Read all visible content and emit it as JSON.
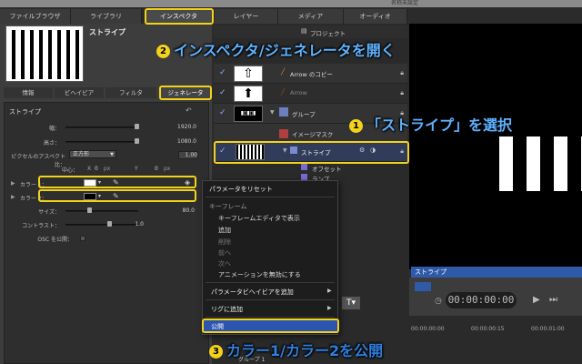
{
  "window": {
    "title": "名称未設定"
  },
  "top_tabs": [
    "ファイルブラウザ",
    "ライブラリ",
    "インスペクタ",
    "レイヤー",
    "メディア",
    "オーディオ"
  ],
  "inspector": {
    "preview_title": "ストライプ",
    "subtabs": [
      "情報",
      "ビヘイビア",
      "フィルタ",
      "ジェネレータ"
    ],
    "section_title": "ストライプ",
    "params": {
      "width": {
        "label": "幅：",
        "value": "1920.0"
      },
      "height": {
        "label": "高さ：",
        "value": "1080.0"
      },
      "pixel_aspect": {
        "label": "ピクセルのアスペクト比：",
        "option": "正方形",
        "value": "1.00"
      },
      "center": {
        "label": "中心：",
        "x_label": "X",
        "x_value": "0",
        "x_unit": "px",
        "y_label": "Y",
        "y_value": "0",
        "y_unit": "px"
      },
      "color1": {
        "label": "カラー 1：",
        "swatch": "#ffffff"
      },
      "color2": {
        "label": "カラー 2：",
        "swatch": "#000000"
      },
      "size": {
        "label": "サイズ：",
        "value": "80.0"
      },
      "contrast": {
        "label": "コントラスト：",
        "value": "1.0"
      },
      "osc": {
        "label": "OSC を公開："
      }
    }
  },
  "layers": {
    "project_label": "プロジェクト",
    "rows": [
      {
        "name": "Arrow のコピー",
        "checked": true,
        "dim": false
      },
      {
        "name": "Arrow",
        "checked": true,
        "dim": true
      },
      {
        "name": "グループ",
        "checked": true,
        "dim": false
      },
      {
        "name": "イメージマスク",
        "checked": false,
        "dim": false
      },
      {
        "name": "ストライプ",
        "checked": true,
        "dim": false
      },
      {
        "name": "オフセット",
        "checked": false,
        "dim": false
      },
      {
        "name": "ランプ",
        "checked": false,
        "dim": false
      }
    ],
    "bottom_group": "グループ 1"
  },
  "canvas": {
    "timeline_label": "ストライプ",
    "timecode": "00:00:00:00",
    "bottom_times": [
      "00:00:00:00",
      "00:00:00:15",
      "00:00:01:00"
    ]
  },
  "context_menu": {
    "items": [
      {
        "label": "パラメータをリセット",
        "type": "item"
      },
      {
        "label": "キーフレーム",
        "type": "header"
      },
      {
        "label": "キーフレームエディタで表示",
        "type": "sub"
      },
      {
        "label": "追加",
        "type": "sub"
      },
      {
        "label": "削除",
        "type": "disabled"
      },
      {
        "label": "前へ",
        "type": "disabled"
      },
      {
        "label": "次へ",
        "type": "disabled"
      },
      {
        "label": "アニメーションを無効にする",
        "type": "sub"
      },
      {
        "label": "パラメータビヘイビアを追加",
        "type": "item",
        "arrow": "▶"
      },
      {
        "label": "リグに追加",
        "type": "item",
        "arrow": "▶"
      },
      {
        "label": "公開",
        "type": "item"
      }
    ]
  },
  "callouts": {
    "step1": {
      "num": "1",
      "text": "「ストライプ」を選択"
    },
    "step2": {
      "num": "2",
      "text": "インスペクタ/ジェネレータを開く"
    },
    "step3": {
      "num": "3",
      "text": "カラー1/カラー2を公開"
    }
  },
  "colors": {
    "accent": "#f3d21a",
    "callout_text": "#5fb2ff",
    "selection": "#2c55b0"
  }
}
